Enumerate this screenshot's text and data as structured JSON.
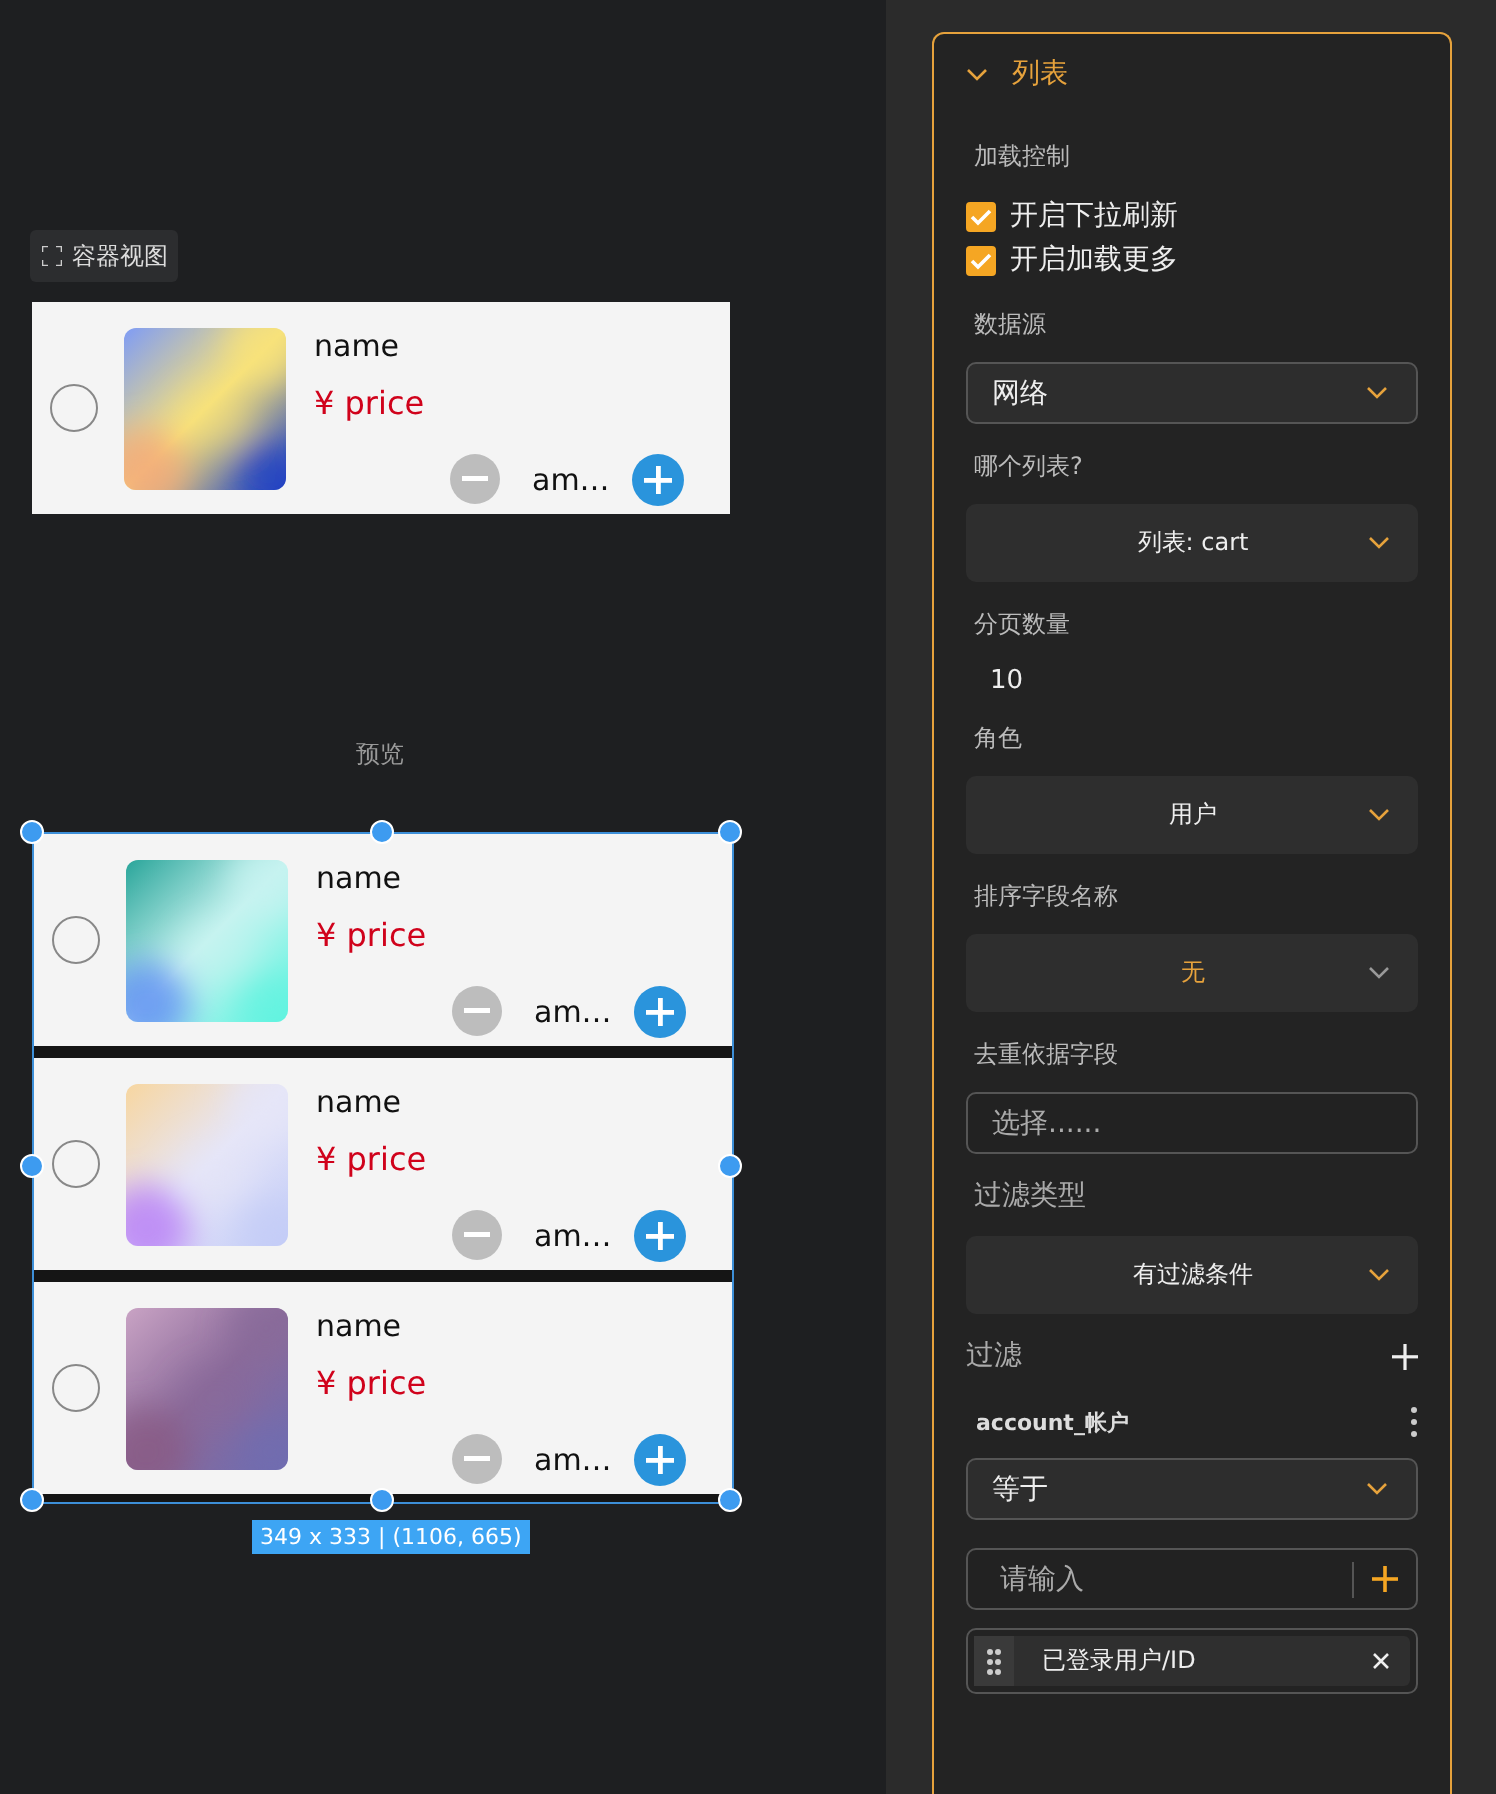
{
  "canvas": {
    "container_button": "容器视图",
    "preview_label": "预览",
    "selection_size": "349 x 333 | (1106, 665)"
  },
  "container_items": [
    {
      "name": "name",
      "price": "¥ price",
      "amount": "am…",
      "checked": false
    }
  ],
  "preview_items": [
    {
      "name": "name",
      "price": "¥ price",
      "amount": "am…",
      "checked": false
    },
    {
      "name": "name",
      "price": "¥ price",
      "amount": "am…",
      "checked": false
    },
    {
      "name": "name",
      "price": "¥ price",
      "amount": "am…",
      "checked": false
    }
  ],
  "panel": {
    "title": "列表",
    "expanded": true,
    "items": [
      {
        "kind": "label",
        "text": "加载控制"
      },
      {
        "kind": "checkbox",
        "text": "开启下拉刷新",
        "checked": true
      },
      {
        "kind": "checkbox",
        "text": "开启加载更多",
        "checked": true
      },
      {
        "kind": "label",
        "text": "数据源"
      },
      {
        "kind": "select",
        "value": "网络"
      },
      {
        "kind": "label",
        "text": "哪个列表?"
      },
      {
        "kind": "picker",
        "value": "列表: cart"
      },
      {
        "kind": "label",
        "text": "分页数量"
      },
      {
        "kind": "number",
        "value": "10"
      },
      {
        "kind": "label",
        "text": "角色"
      },
      {
        "kind": "picker",
        "value": "用户"
      },
      {
        "kind": "label",
        "text": "排序字段名称"
      },
      {
        "kind": "nonepicker",
        "value": "无"
      },
      {
        "kind": "label",
        "text": "去重依据字段"
      },
      {
        "kind": "input",
        "placeholder": "选择......"
      },
      {
        "kind": "heading",
        "text": "过滤类型"
      },
      {
        "kind": "picker",
        "value": "有过滤条件"
      },
      {
        "kind": "add-row",
        "text": "过滤"
      },
      {
        "kind": "field-row",
        "text": "account_帐户"
      },
      {
        "kind": "select",
        "value": "等于"
      },
      {
        "kind": "input-add",
        "placeholder": "请输入"
      },
      {
        "kind": "tag",
        "text": "已登录用户/ID"
      }
    ]
  }
}
